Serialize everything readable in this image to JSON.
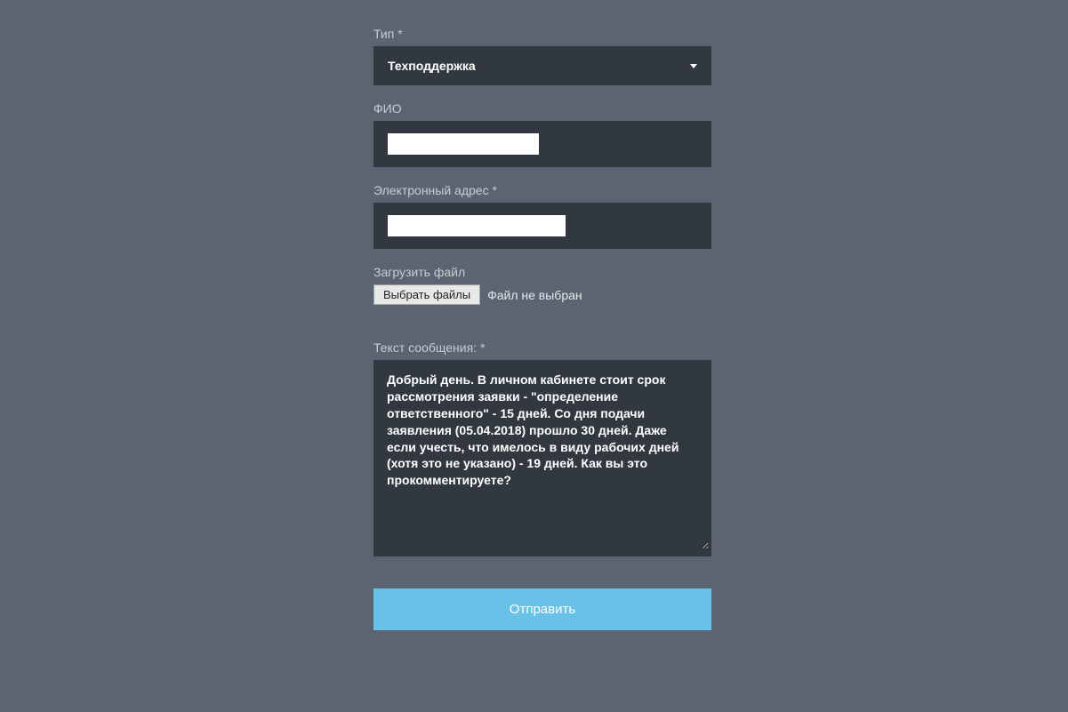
{
  "form": {
    "type": {
      "label": "Тип *",
      "selected": "Техподдержка"
    },
    "fio": {
      "label": "ФИО",
      "value": ""
    },
    "email": {
      "label": "Электронный адрес *",
      "value": ""
    },
    "file": {
      "label": "Загрузить файл",
      "button": "Выбрать файлы",
      "status": "Файл не выбран"
    },
    "message": {
      "label": "Текст сообщения: *",
      "value": "Добрый день. В личном кабинете стоит срок рассмотрения заявки - \"определение ответственного\" - 15 дней. Со дня подачи заявления (05.04.2018) прошло 30 дней. Даже если учесть, что имелось в виду рабочих дней (хотя это не указано) - 19 дней. Как вы это прокомментируете?"
    },
    "submit": "Отправить"
  }
}
